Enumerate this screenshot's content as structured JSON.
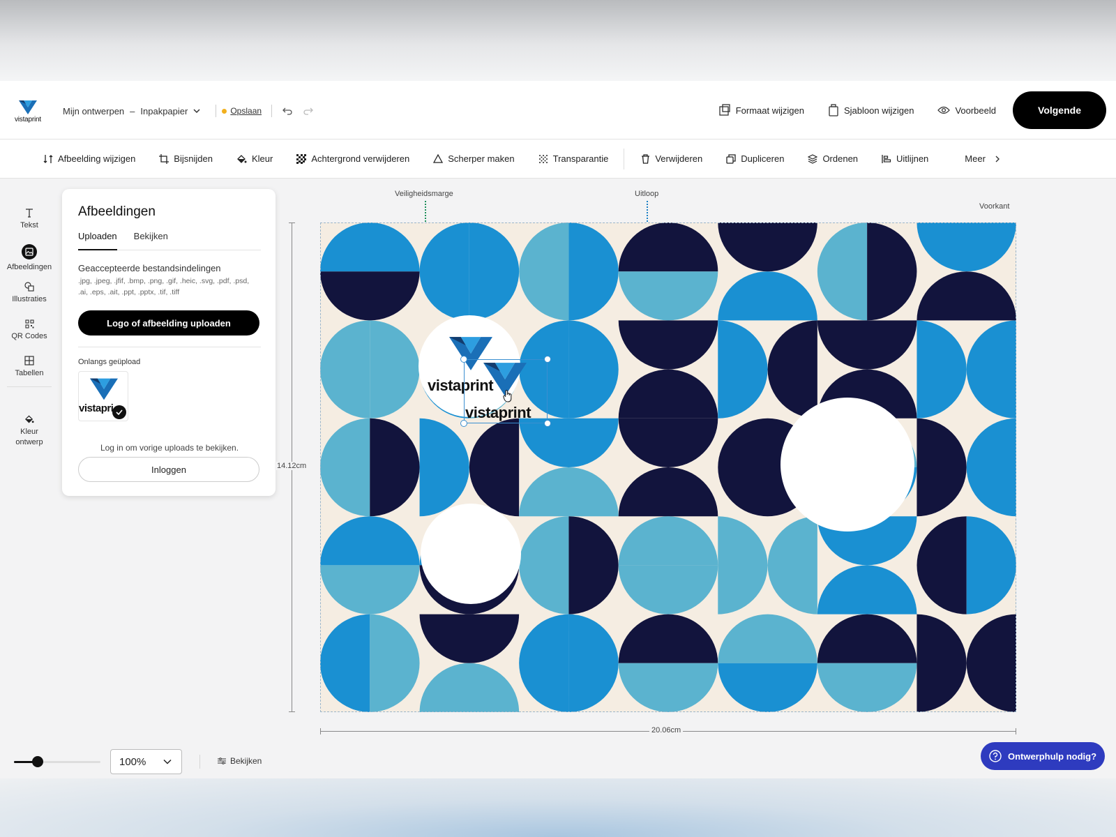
{
  "header": {
    "logo_text": "vistaprint",
    "breadcrumb_root": "Mijn ontwerpen",
    "breadcrumb_dash": "–",
    "product": "Inpakpapier",
    "save_label": "Opslaan",
    "resize_label": "Formaat wijzigen",
    "template_label": "Sjabloon wijzigen",
    "preview_label": "Voorbeeld",
    "next_label": "Volgende"
  },
  "toolbar": {
    "items": [
      {
        "label": "Afbeelding wijzigen",
        "icon": "swap-icon"
      },
      {
        "label": "Bijsnijden",
        "icon": "crop-icon"
      },
      {
        "label": "Kleur",
        "icon": "paint-bucket-icon"
      },
      {
        "label": "Achtergrond verwijderen",
        "icon": "checker-icon"
      },
      {
        "label": "Scherper maken",
        "icon": "triangle-icon"
      },
      {
        "label": "Transparantie",
        "icon": "dots-icon"
      },
      {
        "label": "Verwijderen",
        "icon": "trash-icon"
      },
      {
        "label": "Dupliceren",
        "icon": "copy-icon"
      },
      {
        "label": "Ordenen",
        "icon": "layers-icon"
      },
      {
        "label": "Uitlijnen",
        "icon": "align-icon"
      }
    ],
    "more_label": "Meer"
  },
  "rail": {
    "items": [
      {
        "label": "Tekst",
        "icon": "text-icon"
      },
      {
        "label": "Afbeeldingen",
        "icon": "image-icon"
      },
      {
        "label": "Illustraties",
        "icon": "shapes-icon"
      },
      {
        "label": "QR Codes",
        "icon": "qr-icon"
      },
      {
        "label": "Tabellen",
        "icon": "table-icon"
      },
      {
        "label": "Kleur ontwerp",
        "icon": "paint-bucket-icon"
      }
    ]
  },
  "panel": {
    "title": "Afbeeldingen",
    "tabs": [
      "Uploaden",
      "Bekijken"
    ],
    "formats_heading": "Geaccepteerde bestandsindelingen",
    "formats_list": ".jpg, .jpeg, .jfif, .bmp, .png, .gif, .heic, .svg, .pdf, .psd, .ai, .eps, .ait, .ppt, .pptx, .tif, .tiff",
    "upload_button": "Logo of afbeelding uploaden",
    "recent_heading": "Onlangs geüpload",
    "thumb_text": "vistapri",
    "login_message": "Log in om vorige uploads te bekijken.",
    "login_button": "Inloggen"
  },
  "canvas": {
    "safety_label": "Veiligheidsmarge",
    "bleed_label": "Uitloop",
    "side_label": "Voorkant",
    "height_label": "14.12cm",
    "width_label": "20.06cm",
    "logo_text": "vistaprint",
    "colors": {
      "background": "#f5ede2",
      "navy": "#12143d",
      "blue": "#1a90d2",
      "light_blue": "#5bb3cf"
    }
  },
  "bottom": {
    "zoom_value": "100%",
    "view_label": "Bekijken",
    "help_label": "Ontwerphulp nodig?"
  }
}
